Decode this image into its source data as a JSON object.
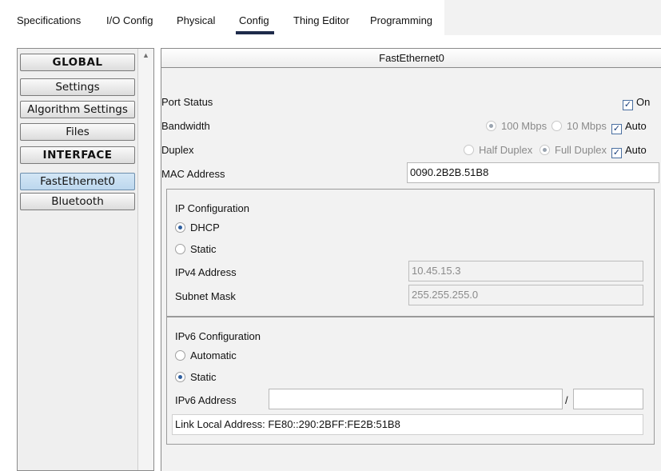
{
  "tabs": [
    {
      "label": "Specifications"
    },
    {
      "label": "I/O Config"
    },
    {
      "label": "Physical"
    },
    {
      "label": "Config"
    },
    {
      "label": "Thing Editor"
    },
    {
      "label": "Programming"
    }
  ],
  "sidebar": {
    "items": [
      {
        "label": "GLOBAL"
      },
      {
        "label": "Settings"
      },
      {
        "label": "Algorithm Settings"
      },
      {
        "label": "Files"
      },
      {
        "label": "INTERFACE"
      },
      {
        "label": "FastEthernet0"
      },
      {
        "label": "Bluetooth"
      }
    ],
    "scroll_up_icon": "▲"
  },
  "panel": {
    "title": "FastEthernet0",
    "port_status": {
      "label": "Port Status",
      "check_label": "On",
      "checked": true
    },
    "bandwidth": {
      "label": "Bandwidth",
      "opt1": "100 Mbps",
      "opt2": "10 Mbps",
      "auto": "Auto"
    },
    "duplex": {
      "label": "Duplex",
      "opt1": "Half Duplex",
      "opt2": "Full Duplex",
      "auto": "Auto"
    },
    "mac": {
      "label": "MAC Address",
      "value": "0090.2B2B.51B8"
    },
    "ipv4": {
      "title": "IP Configuration",
      "dhcp": "DHCP",
      "static": "Static",
      "address_label": "IPv4 Address",
      "address_value": "10.45.15.3",
      "mask_label": "Subnet Mask",
      "mask_value": "255.255.255.0"
    },
    "ipv6": {
      "title": "IPv6 Configuration",
      "automatic": "Automatic",
      "static": "Static",
      "address_label": "IPv6 Address",
      "address_value": "",
      "separator": "/",
      "prefix_value": "",
      "link_local_label": "Link Local Address:",
      "link_local_value": "FE80::290:2BFF:FE2B:51B8"
    }
  },
  "colors": {
    "active_tab_underline": "#1e2b4a",
    "selected_item": "#c6dff2"
  }
}
